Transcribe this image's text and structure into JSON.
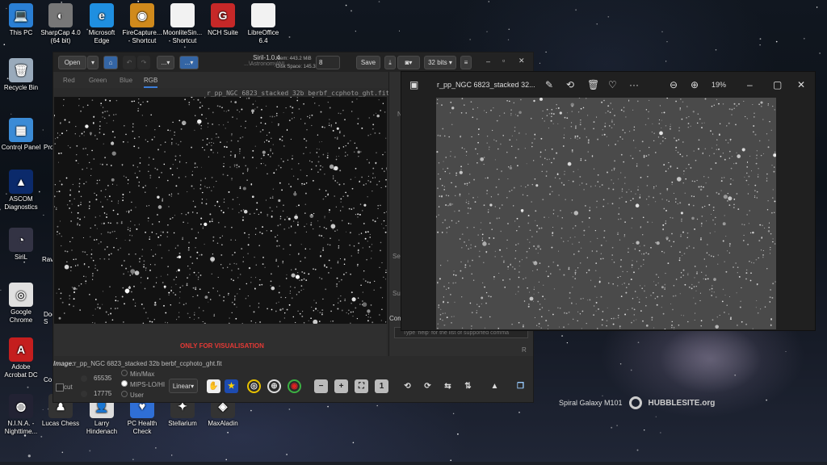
{
  "desktop": {
    "icons": [
      {
        "label": "This PC",
        "color": "#2a7fd4",
        "glyph": "💻"
      },
      {
        "label": "SharpCap 4.0\n(64 bit)",
        "color": "#777",
        "glyph": "◐"
      },
      {
        "label": "Microsoft\nEdge",
        "color": "#1f8fe0",
        "glyph": "e"
      },
      {
        "label": "FireCapture...\n- Shortcut",
        "color": "#d08a1c",
        "glyph": "◉"
      },
      {
        "label": "MoonliteSin...\n- Shortcut",
        "color": "#f2f2f2",
        "glyph": ""
      },
      {
        "label": "NCH Suite",
        "color": "#c62828",
        "glyph": "G"
      },
      {
        "label": "LibreOffice\n6.4",
        "color": "#f2f2f2",
        "glyph": ""
      },
      {
        "label": "Recycle Bin",
        "color": "#9ab",
        "glyph": "🗑"
      },
      {
        "label": "Control Panel",
        "color": "#3b8bd6",
        "glyph": "▦"
      },
      {
        "label": "ASCOM\nDiagnostics",
        "color": "#0b2a6b",
        "glyph": "▲"
      },
      {
        "label": "SiriL",
        "color": "#334",
        "glyph": "◔"
      },
      {
        "label": "Google\nChrome",
        "color": "#e0e0e0",
        "glyph": "◎"
      },
      {
        "label": "Adobe\nAcrobat DC",
        "color": "#c41e1e",
        "glyph": "A"
      },
      {
        "label": "N.I.N.A. -\nNighttime...",
        "color": "#223",
        "glyph": "◍"
      },
      {
        "label": "Lucas Chess",
        "color": "#333",
        "glyph": "♟"
      },
      {
        "label": "Larry\nHindenach",
        "color": "#ddd",
        "glyph": "👤"
      },
      {
        "label": "PC Health\nCheck",
        "color": "#2f6fd6",
        "glyph": "♥"
      },
      {
        "label": "Stellarium",
        "color": "#333",
        "glyph": "✦"
      },
      {
        "label": "MaxAladin",
        "color": "#333",
        "glyph": "◈"
      }
    ],
    "partials": [
      "Pro",
      "Rav",
      "Doc\nS",
      "Co"
    ],
    "wallpaper_credit": {
      "caption": "Spiral Galaxy M101",
      "brand": "HUBBLESITE.org"
    }
  },
  "siril": {
    "open_label": "Open",
    "title": "Siril-1.0.4",
    "path": "...\\Astronomy\\NI...",
    "mem": "Mem: 443.2 MiB",
    "disk": "Disk Space: 145.3 GiB",
    "threads": "8",
    "save_label": "Save",
    "bits": "32 bits",
    "ellipsis": "...",
    "tabs": [
      "Red",
      "Green",
      "Blue",
      "RGB"
    ],
    "active_tab": "RGB",
    "image_name_top": "r_pp_NGC 6823_stacked 32b berbf_ccphoto_ght.fit",
    "visualisation_note": "ONLY FOR VISUALISATION",
    "image_label": "Image:",
    "image_name": "r_pp_NGC 6823_stacked 32b berbf_ccphoto_ght.fit",
    "cut_label": "cut",
    "high_value": "65535",
    "low_value": "17775",
    "modes": [
      "Min/Max",
      "MIPS-LO/HI",
      "User"
    ],
    "selected_mode": "MIPS-LO/HI",
    "stretch": "Linear",
    "side": {
      "letter_n": "N",
      "se": "Se",
      "su": "Su",
      "command_label": "Com",
      "command_placeholder": "Type 'help' for the list of supported comma",
      "r": "R"
    },
    "zoom_buttons": [
      "−",
      "+",
      "⛶",
      "1"
    ]
  },
  "photos": {
    "title": "r_pp_NGC 6823_stacked 32...",
    "zoom": "19%"
  }
}
